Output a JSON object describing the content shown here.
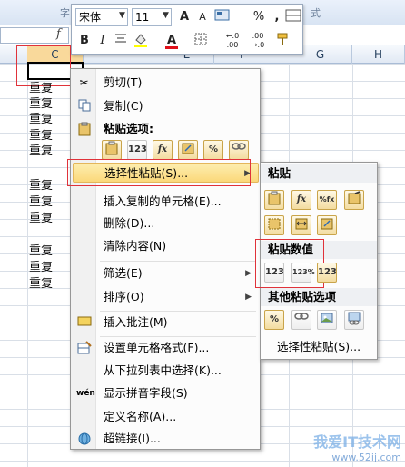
{
  "ribbon": {
    "group_font": "字",
    "group_styles": "式"
  },
  "formula": {
    "fx": "f"
  },
  "columns": [
    "C",
    "E",
    "F",
    "G",
    "H"
  ],
  "cells": [
    "重复",
    "重复",
    "重复",
    "重复",
    "重复",
    "重复",
    "重复",
    "重复",
    "重复",
    "重复",
    "重复",
    "重复"
  ],
  "mini_toolbar": {
    "font_name": "宋体",
    "font_size": "11",
    "grow_font": "A",
    "shrink_font": "A",
    "percent": "%",
    "comma": ",",
    "bold": "B",
    "italic": "I",
    "font_color": "A",
    "inc_decimal": "←.0 .00",
    "dec_decimal": ".00 →.0"
  },
  "context_menu": {
    "cut": "剪切(T)",
    "copy": "复制(C)",
    "paste_options": "粘贴选项:",
    "paste_icons": [
      "123",
      "fx",
      "%"
    ],
    "paste_special": "选择性粘贴(S)...",
    "insert_copied": "插入复制的单元格(E)...",
    "delete": "删除(D)...",
    "clear": "清除内容(N)",
    "filter": "筛选(E)",
    "sort": "排序(O)",
    "insert_comment": "插入批注(M)",
    "format_cells": "设置单元格格式(F)...",
    "pick_list": "从下拉列表中选择(K)...",
    "phonetic": "显示拼音字段(S)",
    "define_name": "定义名称(A)...",
    "hyperlink": "超链接(I)..."
  },
  "submenu": {
    "paste": "粘贴",
    "paste_values": "粘贴数值",
    "other": "其他粘贴选项",
    "paste_special": "选择性粘贴(S)...",
    "icon_fx": "fx",
    "icon_pfx": "%fx",
    "icon_123": "123",
    "icon_123p": "123%",
    "icon_123f": "123",
    "icon_pct": "%"
  },
  "watermark": {
    "main": "我爱IT技术网",
    "url": "www.52ij.com"
  }
}
